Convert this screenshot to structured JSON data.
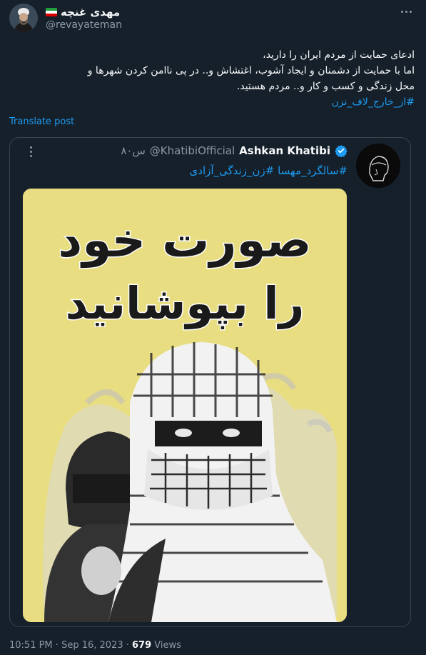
{
  "author": {
    "display_name": "مهدی غنچه",
    "handle": "@revayateman",
    "flag": "iran-flag"
  },
  "post": {
    "lines": [
      "ادعای حمایت از مردم ایران را دارید،",
      "اما با حمایت از دشمنان و ایجاد آشوب، اغتشاش و.. در پی ناامن کردن شهرها و",
      "محل زندگی و کسب و کار و.. مردم هستید."
    ],
    "hashtag": "#از_خارج_لاف_نزن",
    "translate_label": "Translate post"
  },
  "quoted": {
    "name": "Ashkan Khatibi",
    "handle": "@KhatibiOfficial",
    "time": "۸۰س",
    "hashtags": [
      "#سالگرد_مهسا",
      "#زن_زندگی_آزادی"
    ],
    "poster_text": [
      "صورت خود",
      "را بپوشانید"
    ]
  },
  "footer": {
    "time": "10:51 PM",
    "date": "Sep 16, 2023",
    "views_count": "679",
    "views_label": "Views"
  },
  "colors": {
    "background": "#15202b",
    "accent": "#1d9bf0",
    "muted": "#8b98a5",
    "poster_bg": "#e8dd80"
  }
}
